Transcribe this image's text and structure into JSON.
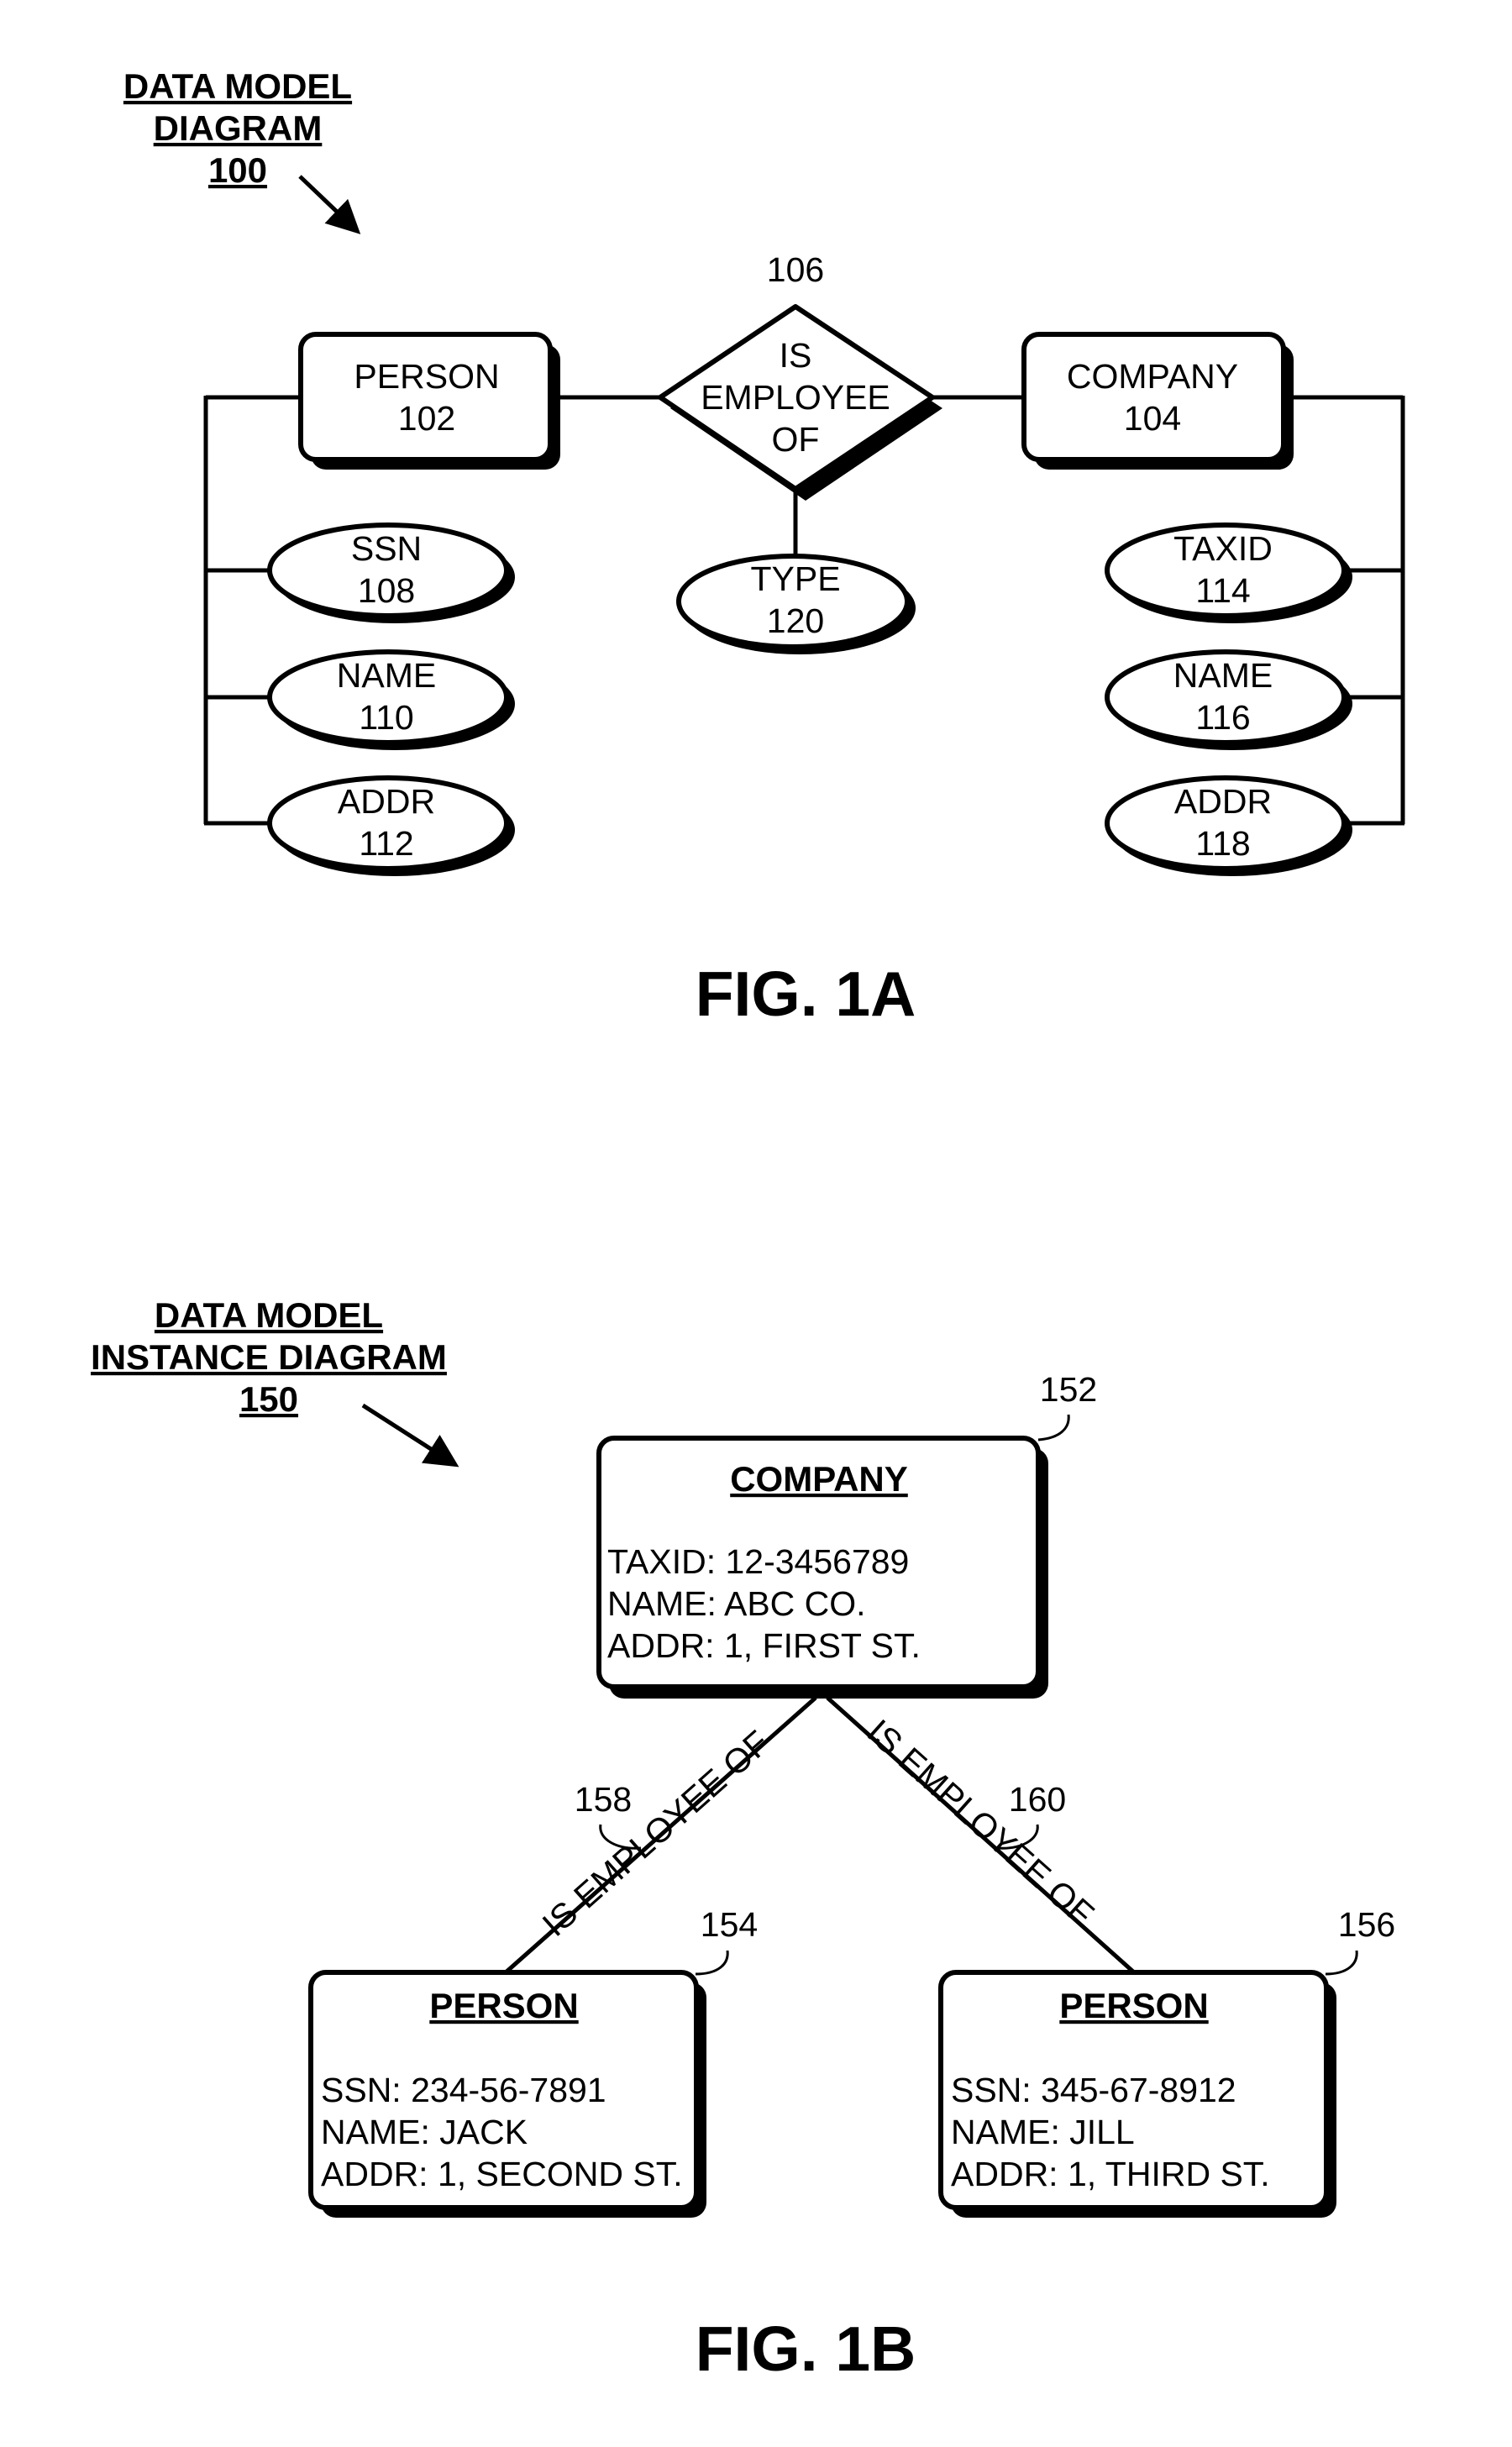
{
  "fig1a": {
    "title_lines": [
      "DATA MODEL",
      "DIAGRAM",
      "100"
    ],
    "caption": "FIG. 1A",
    "entities": {
      "person": {
        "label": "PERSON",
        "ref": "102"
      },
      "company": {
        "label": "COMPANY",
        "ref": "104"
      }
    },
    "relationship": {
      "lines": [
        "IS",
        "EMPLOYEE",
        "OF"
      ],
      "ref": "106"
    },
    "attributes": {
      "ssn": {
        "label": "SSN",
        "ref": "108"
      },
      "person_name": {
        "label": "NAME",
        "ref": "110"
      },
      "person_addr": {
        "label": "ADDR",
        "ref": "112"
      },
      "taxid": {
        "label": "TAXID",
        "ref": "114"
      },
      "company_name": {
        "label": "NAME",
        "ref": "116"
      },
      "company_addr": {
        "label": "ADDR",
        "ref": "118"
      },
      "type": {
        "label": "TYPE",
        "ref": "120"
      }
    }
  },
  "fig1b": {
    "title_lines": [
      "DATA MODEL",
      "INSTANCE DIAGRAM",
      "150"
    ],
    "caption": "FIG. 1B",
    "company": {
      "ref": "152",
      "header": "COMPANY",
      "fields": [
        "TAXID: 12-3456789",
        "NAME: ABC CO.",
        "ADDR: 1, FIRST ST."
      ]
    },
    "person_jack": {
      "ref": "154",
      "header": "PERSON",
      "fields": [
        "SSN: 234-56-7891",
        "NAME: JACK",
        "ADDR: 1, SECOND ST."
      ]
    },
    "person_jill": {
      "ref": "156",
      "header": "PERSON",
      "fields": [
        "SSN: 345-67-8912",
        "NAME: JILL",
        "ADDR: 1, THIRD ST."
      ]
    },
    "edges": {
      "left": {
        "label": "IS EMPLOYEE OF",
        "ref": "158"
      },
      "right": {
        "label": "IS EMPLOYEE OF",
        "ref": "160"
      }
    }
  }
}
